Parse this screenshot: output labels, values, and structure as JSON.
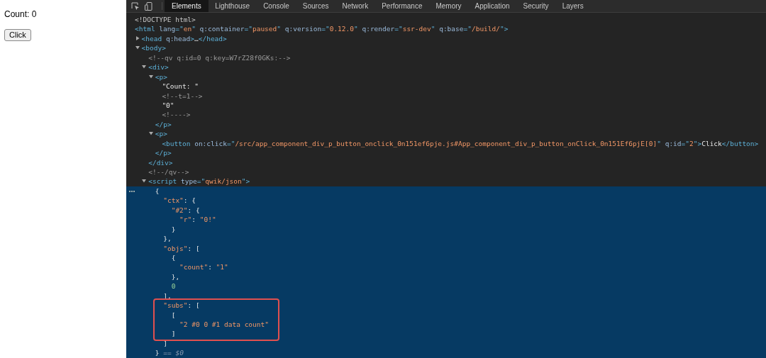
{
  "page": {
    "count_text": "Count: 0",
    "button": "Click"
  },
  "tabs": [
    {
      "label": "Elements",
      "selected": true
    },
    {
      "label": "Lighthouse",
      "selected": false
    },
    {
      "label": "Console",
      "selected": false
    },
    {
      "label": "Sources",
      "selected": false
    },
    {
      "label": "Network",
      "selected": false
    },
    {
      "label": "Performance",
      "selected": false
    },
    {
      "label": "Memory",
      "selected": false
    },
    {
      "label": "Application",
      "selected": false
    },
    {
      "label": "Security",
      "selected": false
    },
    {
      "label": "Layers",
      "selected": false
    }
  ],
  "tree": [
    {
      "selected": false,
      "tokens": [
        {
          "kind": "doctype",
          "text": "<!DOCTYPE html>"
        }
      ]
    },
    {
      "selected": false,
      "tokens": [
        {
          "kind": "tag",
          "text": "<html"
        },
        {
          "kind": "attr",
          "text": " lang"
        },
        {
          "kind": "tag",
          "text": "=\""
        },
        {
          "kind": "value",
          "text": "en"
        },
        {
          "kind": "tag",
          "text": "\""
        },
        {
          "kind": "attr",
          "text": " q:container"
        },
        {
          "kind": "tag",
          "text": "=\""
        },
        {
          "kind": "value",
          "text": "paused"
        },
        {
          "kind": "tag",
          "text": "\""
        },
        {
          "kind": "attr",
          "text": " q:version"
        },
        {
          "kind": "tag",
          "text": "=\""
        },
        {
          "kind": "value",
          "text": "0.12.0"
        },
        {
          "kind": "tag",
          "text": "\""
        },
        {
          "kind": "attr",
          "text": " q:render"
        },
        {
          "kind": "tag",
          "text": "=\""
        },
        {
          "kind": "value",
          "text": "ssr-dev"
        },
        {
          "kind": "tag",
          "text": "\""
        },
        {
          "kind": "attr",
          "text": " q:base"
        },
        {
          "kind": "tag",
          "text": "=\""
        },
        {
          "kind": "value",
          "text": "/build/"
        },
        {
          "kind": "tag",
          "text": "\">"
        }
      ],
      "children": [
        {
          "selected": false,
          "expanded": false,
          "tokens": [
            {
              "kind": "tag",
              "text": "<head"
            },
            {
              "kind": "attr",
              "text": " q:head"
            },
            {
              "kind": "tag",
              "text": ">"
            },
            {
              "kind": "text",
              "text": "…"
            },
            {
              "kind": "tag",
              "text": "</head>"
            }
          ]
        },
        {
          "selected": false,
          "expanded": true,
          "tokens": [
            {
              "kind": "tag",
              "text": "<body>"
            }
          ],
          "children": [
            {
              "selected": false,
              "tokens": [
                {
                  "kind": "comment",
                  "text": "<!--qv q:id=0 q:key=W7rZ28f0GKs:-->"
                }
              ]
            },
            {
              "selected": false,
              "expanded": true,
              "tokens": [
                {
                  "kind": "tag",
                  "text": "<div>"
                }
              ],
              "closing": [
                {
                  "kind": "tag",
                  "text": "</div>"
                }
              ],
              "children": [
                {
                  "selected": false,
                  "expanded": true,
                  "tokens": [
                    {
                      "kind": "tag",
                      "text": "<p>"
                    }
                  ],
                  "closing": [
                    {
                      "kind": "tag",
                      "text": "</p>"
                    }
                  ],
                  "children": [
                    {
                      "selected": false,
                      "tokens": [
                        {
                          "kind": "text",
                          "text": "\"Count: \""
                        }
                      ]
                    },
                    {
                      "selected": false,
                      "tokens": [
                        {
                          "kind": "comment",
                          "text": "<!--t=1-->"
                        }
                      ]
                    },
                    {
                      "selected": false,
                      "tokens": [
                        {
                          "kind": "text",
                          "text": "\"0\""
                        }
                      ]
                    },
                    {
                      "selected": false,
                      "tokens": [
                        {
                          "kind": "comment",
                          "text": "<!---->"
                        }
                      ]
                    }
                  ]
                },
                {
                  "selected": false,
                  "expanded": true,
                  "tokens": [
                    {
                      "kind": "tag",
                      "text": "<p>"
                    }
                  ],
                  "closing": [
                    {
                      "kind": "tag",
                      "text": "</p>"
                    }
                  ],
                  "children": [
                    {
                      "selected": false,
                      "tokens": [
                        {
                          "kind": "tag",
                          "text": "<button"
                        },
                        {
                          "kind": "attr",
                          "text": " on:click"
                        },
                        {
                          "kind": "tag",
                          "text": "=\""
                        },
                        {
                          "kind": "value",
                          "text": "/src/app_component_div_p_button_onclick_0n151ef6pje.js#App_component_div_p_button_onClick_0n151Ef6pjE[0]"
                        },
                        {
                          "kind": "tag",
                          "text": "\""
                        },
                        {
                          "kind": "attr",
                          "text": " q:id"
                        },
                        {
                          "kind": "tag",
                          "text": "=\""
                        },
                        {
                          "kind": "value",
                          "text": "2"
                        },
                        {
                          "kind": "tag",
                          "text": "\">"
                        },
                        {
                          "kind": "text",
                          "text": "Click"
                        },
                        {
                          "kind": "tag",
                          "text": "</button>"
                        }
                      ]
                    }
                  ]
                }
              ]
            },
            {
              "selected": false,
              "tokens": [
                {
                  "kind": "comment",
                  "text": "<!--/qv-->"
                }
              ]
            },
            {
              "selected": false,
              "expanded": true,
              "tokens": [
                {
                  "kind": "tag",
                  "text": "<script"
                },
                {
                  "kind": "attr",
                  "text": " type"
                },
                {
                  "kind": "tag",
                  "text": "=\""
                },
                {
                  "kind": "value",
                  "text": "qwik/json"
                },
                {
                  "kind": "tag",
                  "text": "\">"
                }
              ],
              "children": [
                {
                  "selected": true,
                  "blocks": [
                    {
                      "boxed": false,
                      "lines": [
                        [
                          {
                            "kind": "punct",
                            "text": "{"
                          }
                        ],
                        [
                          {
                            "kind": "string",
                            "text": "  \"ctx\""
                          },
                          {
                            "kind": "punct",
                            "text": ": {"
                          }
                        ],
                        [
                          {
                            "kind": "string",
                            "text": "    \"#2\""
                          },
                          {
                            "kind": "punct",
                            "text": ": {"
                          }
                        ],
                        [
                          {
                            "kind": "string",
                            "text": "      \"r\""
                          },
                          {
                            "kind": "punct",
                            "text": ": "
                          },
                          {
                            "kind": "string",
                            "text": "\"0!\""
                          }
                        ],
                        [
                          {
                            "kind": "punct",
                            "text": "    }"
                          }
                        ],
                        [
                          {
                            "kind": "punct",
                            "text": "  },"
                          }
                        ],
                        [
                          {
                            "kind": "string",
                            "text": "  \"objs\""
                          },
                          {
                            "kind": "punct",
                            "text": ": ["
                          }
                        ],
                        [
                          {
                            "kind": "punct",
                            "text": "    {"
                          }
                        ],
                        [
                          {
                            "kind": "string",
                            "text": "      \"count\""
                          },
                          {
                            "kind": "punct",
                            "text": ": "
                          },
                          {
                            "kind": "string",
                            "text": "\"1\""
                          }
                        ],
                        [
                          {
                            "kind": "punct",
                            "text": "    },"
                          }
                        ],
                        [
                          {
                            "kind": "number",
                            "text": "    0"
                          }
                        ],
                        [
                          {
                            "kind": "punct",
                            "text": "  ],"
                          }
                        ]
                      ]
                    },
                    {
                      "boxed": true,
                      "lines": [
                        [
                          {
                            "kind": "string",
                            "text": "  \"subs\""
                          },
                          {
                            "kind": "punct",
                            "text": ": ["
                          }
                        ],
                        [
                          {
                            "kind": "punct",
                            "text": "    ["
                          }
                        ],
                        [
                          {
                            "kind": "string",
                            "text": "      \"2 #0 0 #1 data count\""
                          }
                        ],
                        [
                          {
                            "kind": "punct",
                            "text": "    ]"
                          }
                        ]
                      ]
                    },
                    {
                      "boxed": false,
                      "lines": [
                        [
                          {
                            "kind": "punct",
                            "text": "  ]"
                          }
                        ],
                        [
                          {
                            "kind": "punct",
                            "text": "}"
                          },
                          {
                            "kind": "console",
                            "text": " == $0"
                          }
                        ]
                      ]
                    }
                  ]
                }
              ]
            }
          ]
        }
      ]
    }
  ]
}
